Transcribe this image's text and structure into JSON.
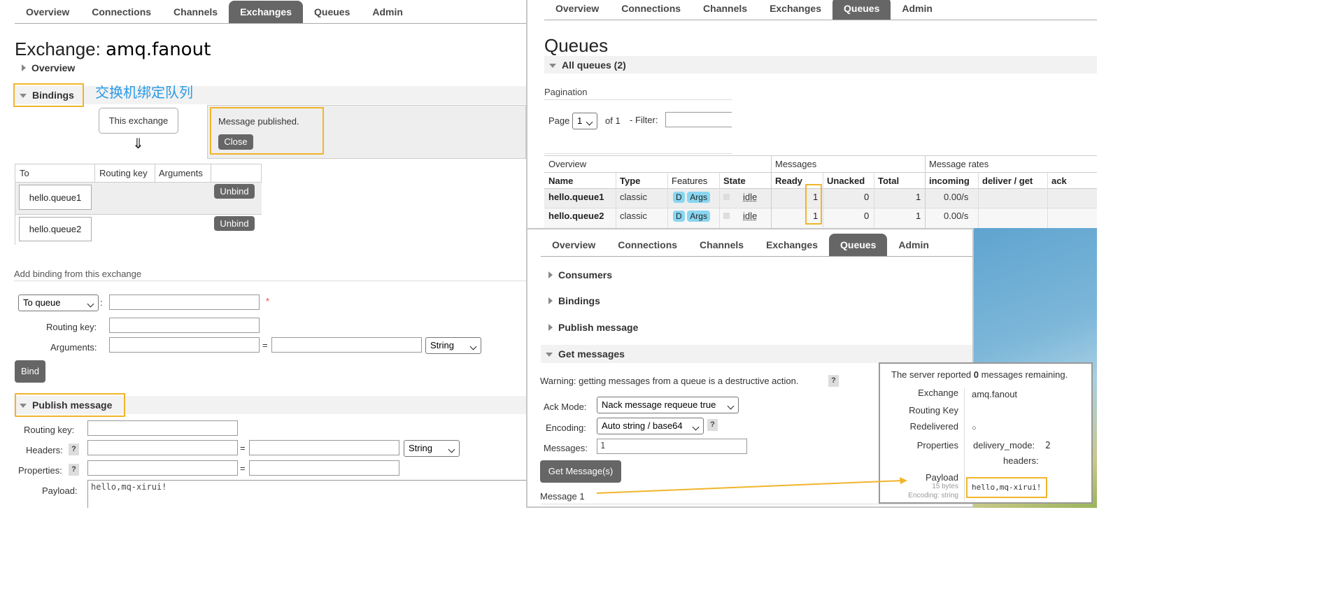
{
  "left": {
    "nav": [
      "Overview",
      "Connections",
      "Channels",
      "Exchanges",
      "Queues",
      "Admin"
    ],
    "active_tab": "Exchanges",
    "title_prefix": "Exchange: ",
    "title_name": "amq.fanout",
    "overview_label": "Overview",
    "bindings_label": "Bindings",
    "annotation": "交换机绑定队列",
    "this_exchange": "This exchange",
    "down_arrow": "⇓",
    "published_msg": "Message published.",
    "close_label": "Close",
    "bind_table": {
      "headers": [
        "To",
        "Routing key",
        "Arguments",
        ""
      ],
      "rows": [
        {
          "to": "hello.queue1",
          "action": "Unbind"
        },
        {
          "to": "hello.queue2",
          "action": "Unbind"
        }
      ]
    },
    "add_binding_label": "Add binding from this exchange",
    "to_queue_select": "To queue",
    "colon": ":",
    "required_star": "*",
    "routing_key_label": "Routing key:",
    "arguments_label": "Arguments:",
    "equals": "=",
    "string_select": "String",
    "bind_button": "Bind",
    "publish_label": "Publish message",
    "pub_routing_key_label": "Routing key:",
    "pub_headers_label": "Headers:",
    "pub_properties_label": "Properties:",
    "help": "?",
    "pub_string_select": "String",
    "payload_label": "Payload:",
    "payload_value": "hello,mq-xirui!"
  },
  "queues": {
    "nav": [
      "Overview",
      "Connections",
      "Channels",
      "Exchanges",
      "Queues",
      "Admin"
    ],
    "active_tab": "Queues",
    "title": "Queues",
    "all_queues": "All queues (2)",
    "pagination_label": "Pagination",
    "page_label": "Page",
    "page_value": "1",
    "of_label": "of 1",
    "filter_label": "- Filter:",
    "groups": [
      "Overview",
      "Messages",
      "Message rates"
    ],
    "columns": [
      "Name",
      "Type",
      "Features",
      "State",
      "Ready",
      "Unacked",
      "Total",
      "incoming",
      "deliver / get",
      "ack"
    ],
    "rows": [
      {
        "name": "hello.queue1",
        "type": "classic",
        "f1": "D",
        "f2": "Args",
        "state": "idle",
        "ready": "1",
        "unacked": "0",
        "total": "1",
        "incoming": "0.00/s"
      },
      {
        "name": "hello.queue2",
        "type": "classic",
        "f1": "D",
        "f2": "Args",
        "state": "idle",
        "ready": "1",
        "unacked": "0",
        "total": "1",
        "incoming": "0.00/s"
      }
    ]
  },
  "detail": {
    "nav": [
      "Overview",
      "Connections",
      "Channels",
      "Exchanges",
      "Queues",
      "Admin"
    ],
    "active_tab": "Queues",
    "consumers_label": "Consumers",
    "bindings_label": "Bindings",
    "publish_label": "Publish message",
    "get_label": "Get messages",
    "warning": "Warning: getting messages from a queue is a destructive action.",
    "help": "?",
    "ack_label": "Ack Mode:",
    "ack_value": "Nack message requeue true",
    "enc_label": "Encoding:",
    "enc_value": "Auto string / base64",
    "msgs_label": "Messages:",
    "msgs_value": "1",
    "get_button": "Get Message(s)",
    "message_label": "Message 1"
  },
  "result": {
    "reported_prefix": "The server reported ",
    "reported_count": "0",
    "reported_suffix": " messages remaining.",
    "exchange_label": "Exchange",
    "exchange_value": "amq.fanout",
    "routing_label": "Routing Key",
    "redelivered_label": "Redelivered",
    "redelivered_value": "○",
    "properties_label": "Properties",
    "delivery_mode_label": "delivery_mode:",
    "delivery_mode_value": "2",
    "headers_label": "headers:",
    "payload_label": "Payload",
    "payload_bytes": "15 bytes",
    "payload_encoding": "Encoding: string",
    "payload_value": "hello,mq-xirui!"
  },
  "colors": {
    "highlight": "#f1b52b",
    "tab_active": "#666666",
    "annotation": "#2a9ae8",
    "arrow": "#f1b52b"
  }
}
